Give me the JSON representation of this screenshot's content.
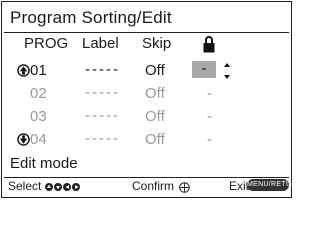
{
  "screen": {
    "title": "Program Sorting/Edit"
  },
  "columns": {
    "prog": "PROG",
    "label": "Label",
    "skip": "Skip"
  },
  "rows": [
    {
      "prog": "01",
      "label": "-----",
      "skip": "Off",
      "lock": "-",
      "state": "selected",
      "icon": "up-arrow-circle-icon"
    },
    {
      "prog": "02",
      "label": "-----",
      "skip": "Off",
      "lock": "-",
      "state": "dim"
    },
    {
      "prog": "03",
      "label": "-----",
      "skip": "Off",
      "lock": "-",
      "state": "dim"
    },
    {
      "prog": "04",
      "label": "-----",
      "skip": "Off",
      "lock": "-",
      "state": "dim",
      "icon": "down-arrow-circle-icon"
    }
  ],
  "mode_text": "Edit mode",
  "footer": {
    "select_label": "Select",
    "confirm_label": "Confirm",
    "exit_label": "Exit",
    "exit_button_text": "MENU/RETURN"
  },
  "colors": {
    "text": "#1a1a1a",
    "dim_text": "#9a9a9a",
    "highlight": "#a9a9a9",
    "border": "#222222"
  }
}
